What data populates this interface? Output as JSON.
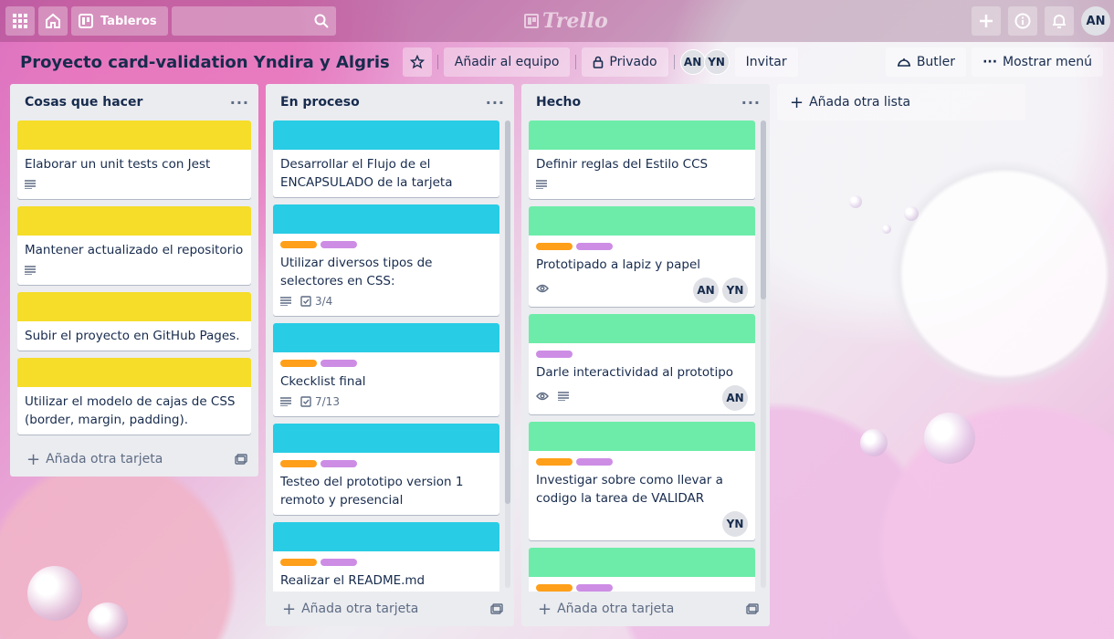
{
  "topbar": {
    "boards_label": "Tableros",
    "logo": "Trello",
    "user_initials": "AN"
  },
  "board": {
    "title": "Proyecto card-validation Yndira y Algris",
    "team_button": "Añadir al equipo",
    "privacy": "Privado",
    "members": [
      "AN",
      "YN"
    ],
    "invite": "Invitar",
    "butler": "Butler",
    "menu": "Mostrar menú"
  },
  "colors": {
    "yellow": "#f5dd29",
    "sky": "#29cce5",
    "green": "#6deca9",
    "orange": "#ff9f1a",
    "purple": "#cd8de5"
  },
  "lists": [
    {
      "title": "Cosas que hacer",
      "add_card": "Añada otra tarjeta",
      "cards": [
        {
          "title": "Elaborar un unit tests con Jest"
        },
        {
          "title": "Mantener actualizado el repositorio"
        },
        {
          "title": "Subir el proyecto en GitHub Pages."
        },
        {
          "title": "Utilizar el modelo de cajas de CSS (border, margin, padding)."
        }
      ]
    },
    {
      "title": "En proceso",
      "add_card": "Añada otra tarjeta",
      "cards": [
        {
          "title": "Desarrollar el Flujo de el ENCAPSULADO de la tarjeta"
        },
        {
          "title": "Utilizar diversos tipos de selectores en CSS:",
          "checklist": "3/4"
        },
        {
          "title": "Ckecklist final",
          "checklist": "7/13"
        },
        {
          "title": "Testeo del prototipo version 1 remoto y presencial"
        },
        {
          "title": "Realizar el README.md"
        }
      ]
    },
    {
      "title": "Hecho",
      "add_card": "Añada otra tarjeta",
      "cards": [
        {
          "title": "Definir reglas del Estilo CCS"
        },
        {
          "title": "Prototipado a lapiz y papel",
          "members": [
            "AN",
            "YN"
          ]
        },
        {
          "title": "Darle interactividad al prototipo",
          "members": [
            "AN"
          ]
        },
        {
          "title": "Investigar sobre como llevar a codigo la tarea de VALIDAR",
          "members": [
            "YN"
          ]
        },
        {
          "title": ""
        }
      ]
    }
  ],
  "add_list": "Añada otra lista"
}
